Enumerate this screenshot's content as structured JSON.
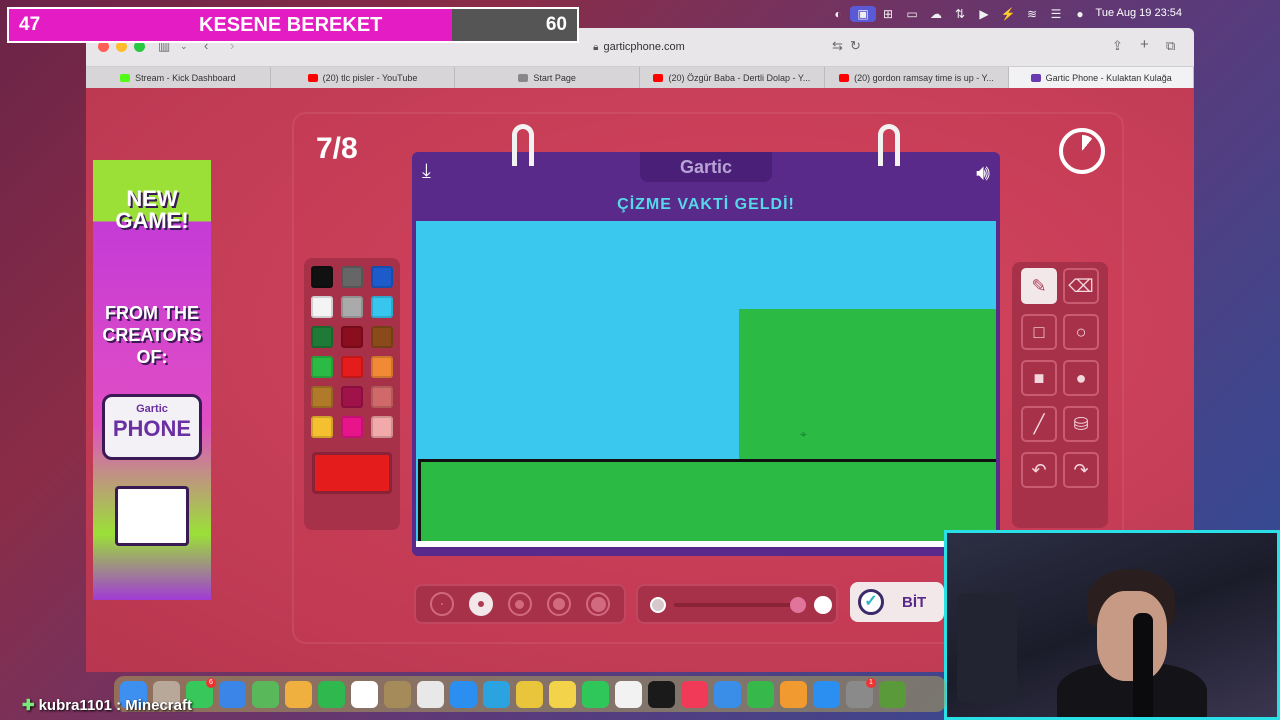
{
  "menubar": {
    "clock": "Tue Aug 19  23:54",
    "icons": [
      "circle-icon",
      "screen-share-icon",
      "grid-icon",
      "battery-icon",
      "cloud-icon",
      "slider-icon",
      "play-icon",
      "battery-charge-icon",
      "wifi-icon",
      "control-center-icon",
      "user-icon"
    ]
  },
  "goal": {
    "current": "47",
    "title": "KESENE BEREKET",
    "max": "60",
    "progress": 0.78,
    "fill_color": "#e31cc3"
  },
  "browser": {
    "url": "garticphone.com",
    "tabs": [
      {
        "label": "Stream - Kick Dashboard",
        "icon_color": "#53fc18"
      },
      {
        "label": "(20) tlc pisler - YouTube",
        "icon_color": "#ff0000"
      },
      {
        "label": "Start Page",
        "icon_color": "#888888"
      },
      {
        "label": "(20) Özgür Baba - Dertli Dolap - Y...",
        "icon_color": "#ff0000"
      },
      {
        "label": "(20) gordon ramsay time is up - Y...",
        "icon_color": "#ff0000"
      },
      {
        "label": "Gartic Phone - Kulaktan Kulağa",
        "icon_color": "#6a3bb0",
        "active": true
      }
    ]
  },
  "ad": {
    "line1": "NEW GAME!",
    "line2": "FROM THE CREATORS OF:",
    "logo_top": "Gartic",
    "logo_bottom": "PHONE"
  },
  "game": {
    "round": "7/8",
    "brand": "Gartic",
    "prompt": "ÇİZME VAKTİ GELDİ!",
    "done_label": "BİT",
    "timer_remaining": 0.89,
    "palette": [
      "#111111",
      "#666666",
      "#1c5bc9",
      "#f4f4f4",
      "#aaaaaa",
      "#36c6ee",
      "#1e7a36",
      "#8a0e1e",
      "#8a4a1a",
      "#2bbb45",
      "#e41c1c",
      "#f08a34",
      "#b07a2a",
      "#a0124a",
      "#d06a6a",
      "#f4c030",
      "#e8148a",
      "#f2a9a9"
    ],
    "selected_color": "#e41c1c",
    "tools": [
      "pencil-icon",
      "eraser-icon",
      "rect-outline-icon",
      "circle-outline-icon",
      "rect-filled-icon",
      "circle-filled-icon",
      "line-icon",
      "bucket-icon",
      "undo-icon",
      "redo-icon"
    ],
    "active_tool": "pencil-icon",
    "brush_sizes": [
      2,
      6,
      9,
      12,
      15
    ],
    "active_brush": 1
  },
  "canvas": {
    "background": "#3ac8ee",
    "shapes": [
      {
        "type": "rect",
        "color": "#2bbb45"
      },
      {
        "type": "rect",
        "color": "#2bbb45",
        "outline": "#111111"
      }
    ]
  },
  "dock": {
    "apps": [
      {
        "name": "finder",
        "color": "#3d8ff0"
      },
      {
        "name": "launchpad",
        "color": "#b8a89a"
      },
      {
        "name": "messages",
        "color": "#38c75a",
        "badge": "6"
      },
      {
        "name": "mail",
        "color": "#3b84e8"
      },
      {
        "name": "maps",
        "color": "#58b85a"
      },
      {
        "name": "photos",
        "color": "#f0b040"
      },
      {
        "name": "facetime",
        "color": "#2fb84e"
      },
      {
        "name": "calendar",
        "color": "#ffffff"
      },
      {
        "name": "notes",
        "color": "#a58a5a"
      },
      {
        "name": "reminders",
        "color": "#e8e8e8"
      },
      {
        "name": "safari",
        "color": "#2a8ff0"
      },
      {
        "name": "telegram",
        "color": "#2aa3e0"
      },
      {
        "name": "chrome",
        "color": "#e8c53a"
      },
      {
        "name": "notes2",
        "color": "#f2d34a"
      },
      {
        "name": "whatsapp",
        "color": "#30c75a"
      },
      {
        "name": "freeform",
        "color": "#f2f2f2"
      },
      {
        "name": "appletv",
        "color": "#1a1a1a"
      },
      {
        "name": "music",
        "color": "#f03a58"
      },
      {
        "name": "keynote",
        "color": "#3a8ee8"
      },
      {
        "name": "numbers",
        "color": "#36b84a"
      },
      {
        "name": "pages",
        "color": "#f09a30"
      },
      {
        "name": "appstore",
        "color": "#2a8ff0"
      },
      {
        "name": "settings",
        "color": "#8a8a8a",
        "badge": "1"
      },
      {
        "name": "minecraft",
        "color": "#5a9a3a"
      }
    ]
  },
  "chat": {
    "user": "kubra1101",
    "text": " : Minecraft"
  }
}
